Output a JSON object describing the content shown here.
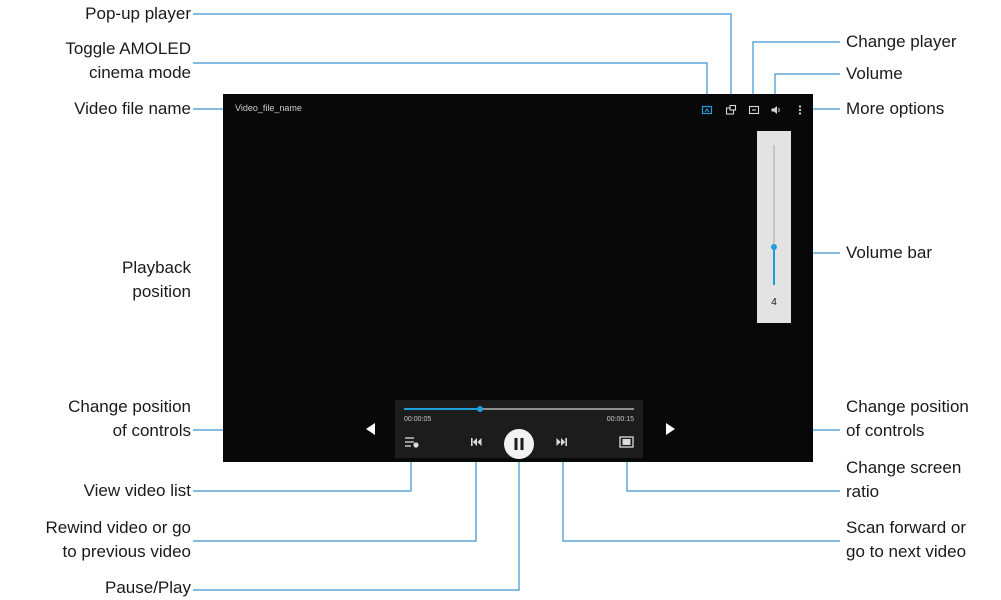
{
  "video_screen": {
    "file_name": "Video_file_name",
    "elapsed_time": "00:00:05",
    "total_time": "00:00:15",
    "playback_progress": 0.33,
    "volume_level": "4",
    "volume_fraction": 0.27,
    "accent_color": "#1e9fdc"
  },
  "callouts": {
    "popup_player": "Pop-up player",
    "toggle_amoled_1": "Toggle AMOLED",
    "toggle_amoled_2": "cinema mode",
    "video_file_name": "Video file name",
    "change_player": "Change player",
    "volume": "Volume",
    "more_options": "More options",
    "volume_bar": "Volume bar",
    "playback_position_1": "Playback",
    "playback_position_2": "position",
    "change_position_left_1": "Change position",
    "change_position_left_2": "of controls",
    "change_position_right_1": "Change position",
    "change_position_right_2": "of controls",
    "view_video_list": "View video list",
    "change_screen_ratio_1": "Change screen",
    "change_screen_ratio_2": "ratio",
    "rewind_1": "Rewind video or go",
    "rewind_2": "to previous video",
    "scan_forward_1": "Scan forward or",
    "scan_forward_2": "go to next video",
    "pause_play": "Pause/Play"
  }
}
